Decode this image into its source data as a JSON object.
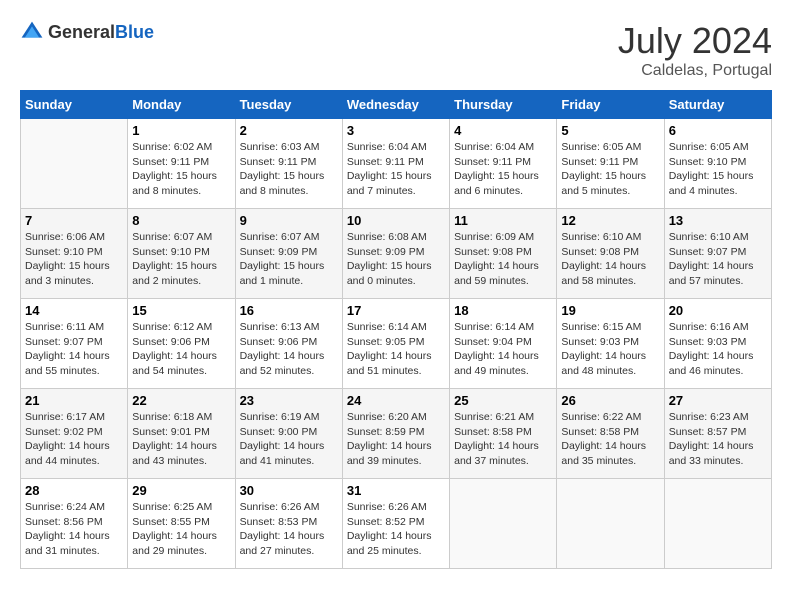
{
  "header": {
    "logo_general": "General",
    "logo_blue": "Blue",
    "month": "July 2024",
    "location": "Caldelas, Portugal"
  },
  "days_of_week": [
    "Sunday",
    "Monday",
    "Tuesday",
    "Wednesday",
    "Thursday",
    "Friday",
    "Saturday"
  ],
  "weeks": [
    [
      {
        "day": "",
        "info": ""
      },
      {
        "day": "1",
        "info": "Sunrise: 6:02 AM\nSunset: 9:11 PM\nDaylight: 15 hours\nand 8 minutes."
      },
      {
        "day": "2",
        "info": "Sunrise: 6:03 AM\nSunset: 9:11 PM\nDaylight: 15 hours\nand 8 minutes."
      },
      {
        "day": "3",
        "info": "Sunrise: 6:04 AM\nSunset: 9:11 PM\nDaylight: 15 hours\nand 7 minutes."
      },
      {
        "day": "4",
        "info": "Sunrise: 6:04 AM\nSunset: 9:11 PM\nDaylight: 15 hours\nand 6 minutes."
      },
      {
        "day": "5",
        "info": "Sunrise: 6:05 AM\nSunset: 9:11 PM\nDaylight: 15 hours\nand 5 minutes."
      },
      {
        "day": "6",
        "info": "Sunrise: 6:05 AM\nSunset: 9:10 PM\nDaylight: 15 hours\nand 4 minutes."
      }
    ],
    [
      {
        "day": "7",
        "info": "Sunrise: 6:06 AM\nSunset: 9:10 PM\nDaylight: 15 hours\nand 3 minutes."
      },
      {
        "day": "8",
        "info": "Sunrise: 6:07 AM\nSunset: 9:10 PM\nDaylight: 15 hours\nand 2 minutes."
      },
      {
        "day": "9",
        "info": "Sunrise: 6:07 AM\nSunset: 9:09 PM\nDaylight: 15 hours\nand 1 minute."
      },
      {
        "day": "10",
        "info": "Sunrise: 6:08 AM\nSunset: 9:09 PM\nDaylight: 15 hours\nand 0 minutes."
      },
      {
        "day": "11",
        "info": "Sunrise: 6:09 AM\nSunset: 9:08 PM\nDaylight: 14 hours\nand 59 minutes."
      },
      {
        "day": "12",
        "info": "Sunrise: 6:10 AM\nSunset: 9:08 PM\nDaylight: 14 hours\nand 58 minutes."
      },
      {
        "day": "13",
        "info": "Sunrise: 6:10 AM\nSunset: 9:07 PM\nDaylight: 14 hours\nand 57 minutes."
      }
    ],
    [
      {
        "day": "14",
        "info": "Sunrise: 6:11 AM\nSunset: 9:07 PM\nDaylight: 14 hours\nand 55 minutes."
      },
      {
        "day": "15",
        "info": "Sunrise: 6:12 AM\nSunset: 9:06 PM\nDaylight: 14 hours\nand 54 minutes."
      },
      {
        "day": "16",
        "info": "Sunrise: 6:13 AM\nSunset: 9:06 PM\nDaylight: 14 hours\nand 52 minutes."
      },
      {
        "day": "17",
        "info": "Sunrise: 6:14 AM\nSunset: 9:05 PM\nDaylight: 14 hours\nand 51 minutes."
      },
      {
        "day": "18",
        "info": "Sunrise: 6:14 AM\nSunset: 9:04 PM\nDaylight: 14 hours\nand 49 minutes."
      },
      {
        "day": "19",
        "info": "Sunrise: 6:15 AM\nSunset: 9:03 PM\nDaylight: 14 hours\nand 48 minutes."
      },
      {
        "day": "20",
        "info": "Sunrise: 6:16 AM\nSunset: 9:03 PM\nDaylight: 14 hours\nand 46 minutes."
      }
    ],
    [
      {
        "day": "21",
        "info": "Sunrise: 6:17 AM\nSunset: 9:02 PM\nDaylight: 14 hours\nand 44 minutes."
      },
      {
        "day": "22",
        "info": "Sunrise: 6:18 AM\nSunset: 9:01 PM\nDaylight: 14 hours\nand 43 minutes."
      },
      {
        "day": "23",
        "info": "Sunrise: 6:19 AM\nSunset: 9:00 PM\nDaylight: 14 hours\nand 41 minutes."
      },
      {
        "day": "24",
        "info": "Sunrise: 6:20 AM\nSunset: 8:59 PM\nDaylight: 14 hours\nand 39 minutes."
      },
      {
        "day": "25",
        "info": "Sunrise: 6:21 AM\nSunset: 8:58 PM\nDaylight: 14 hours\nand 37 minutes."
      },
      {
        "day": "26",
        "info": "Sunrise: 6:22 AM\nSunset: 8:58 PM\nDaylight: 14 hours\nand 35 minutes."
      },
      {
        "day": "27",
        "info": "Sunrise: 6:23 AM\nSunset: 8:57 PM\nDaylight: 14 hours\nand 33 minutes."
      }
    ],
    [
      {
        "day": "28",
        "info": "Sunrise: 6:24 AM\nSunset: 8:56 PM\nDaylight: 14 hours\nand 31 minutes."
      },
      {
        "day": "29",
        "info": "Sunrise: 6:25 AM\nSunset: 8:55 PM\nDaylight: 14 hours\nand 29 minutes."
      },
      {
        "day": "30",
        "info": "Sunrise: 6:26 AM\nSunset: 8:53 PM\nDaylight: 14 hours\nand 27 minutes."
      },
      {
        "day": "31",
        "info": "Sunrise: 6:26 AM\nSunset: 8:52 PM\nDaylight: 14 hours\nand 25 minutes."
      },
      {
        "day": "",
        "info": ""
      },
      {
        "day": "",
        "info": ""
      },
      {
        "day": "",
        "info": ""
      }
    ]
  ]
}
